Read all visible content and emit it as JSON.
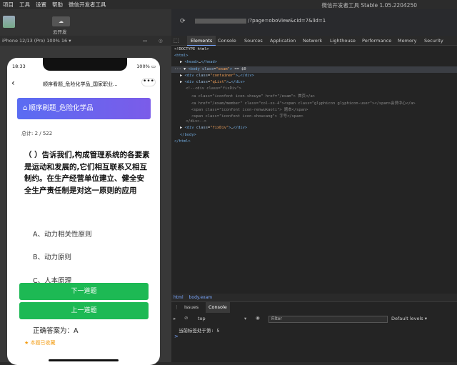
{
  "menu": [
    "项目",
    "工具",
    "设置",
    "帮助",
    "微信开发者工具"
  ],
  "app_title": "微信开发者工具 Stable 1.05.2204250",
  "toolbar": {
    "cloud_label": "云开发",
    "cloud_icon": "cloud-dev-icon"
  },
  "address": {
    "url_suffix": "/?page=oboView&cid=7&lid=1"
  },
  "simulator": {
    "device": "iPhone 12/13 (Pro) 100% 16 ▾"
  },
  "phone": {
    "time": "18:33",
    "battery": "100%",
    "nav_title": "顺序看题_危险化学品_国家职业...",
    "nav_dots": "•••",
    "banner": "顺序刷题_危险化学品",
    "total": "总计: 2 / 522",
    "question": "（ ）告诉我们,构成管理系统的各要素是运动和发展的,它们相互联系又相互制约。在生产经营单位建立、健全安全生产责任制是对这一原则的应用",
    "options": [
      "A、动力相关性原则",
      "B、动力原则",
      "C、人本原理"
    ],
    "next_button": "下一道题",
    "prev_button": "上一道题",
    "answer": "正确答案为：A",
    "favorite": "本题已收藏"
  },
  "devtools": {
    "tabs": [
      "Elements",
      "Console",
      "Sources",
      "Application",
      "Network",
      "Lighthouse",
      "Performance",
      "Memory",
      "Security"
    ],
    "lines": [
      {
        "indent": 0,
        "html": "&lt;!DOCTYPE html&gt;"
      },
      {
        "indent": 0,
        "html": "<span class='tag'>&lt;html&gt;</span>"
      },
      {
        "indent": 1,
        "html": "▶ <span class='tag'>&lt;head&gt;</span>…<span class='tag'>&lt;/head&gt;</span>"
      },
      {
        "indent": 0,
        "html": "··· ▼ <span class='tag'>&lt;body</span> <span class='attr'>class</span>=<span class='val'>\"exam\"</span><span class='tag'>&gt;</span> == $0"
      },
      {
        "indent": 1,
        "html": "▶ <span class='tag'>&lt;div</span> <span class='attr'>class</span>=<span class='val'>\"container\"</span><span class='tag'>&gt;</span>…<span class='tag'>&lt;/div&gt;</span>"
      },
      {
        "indent": 1,
        "html": "▶ <span class='tag'>&lt;div</span> <span class='attr'>class</span>=<span class='val'>\"qList\"</span><span class='tag'>&gt;</span>…<span class='tag'>&lt;/div&gt;</span>"
      },
      {
        "indent": 2,
        "html": "<span class='cmt'>&lt;!--&lt;div class=\"fixDiv\"&gt;</span>"
      },
      {
        "indent": 3,
        "html": "<span class='cmt'>&lt;a class=\"iconfont icon-shouye\" href=\"/exam\"&gt; 首页&lt;/a&gt;</span>"
      },
      {
        "indent": 3,
        "html": "<span class='cmt'>&lt;a href=\"/exam/member\" class=\"col-xs-4\"&gt;&lt;span class=\"glyphicon glyphicon-user\"&gt;&lt;/span&gt;会员中心&lt;/a&gt;</span>"
      },
      {
        "indent": 3,
        "html": "<span class='cmt'>&lt;span class=\"iconfont icon-renwukaoti\"&gt; 题本&lt;/span&gt;</span>"
      },
      {
        "indent": 3,
        "html": "<span class='cmt'>&lt;span class=\"iconfont icon-shoucang\"&gt; 字号&lt;/span&gt;</span>"
      },
      {
        "indent": 2,
        "html": "<span class='cmt'>&lt;/div&gt;--&gt;</span>"
      },
      {
        "indent": 1,
        "html": "▶ <span class='tag'>&lt;div</span> <span class='attr'>class</span>=<span class='val'>\"fixDiv\"</span><span class='tag'>&gt;</span>…<span class='tag'>&lt;/div&gt;</span>"
      },
      {
        "indent": 1,
        "html": "<span class='tag'>&lt;/body&gt;</span>"
      },
      {
        "indent": 0,
        "html": "<span class='tag'>&lt;/html&gt;</span>"
      }
    ],
    "breadcrumb": [
      "html",
      "body.exam"
    ],
    "drawer_tabs": [
      "Issues",
      "Console"
    ],
    "context": "top",
    "filter_placeholder": "Filter",
    "levels": "Default levels ▾",
    "log": "当前标签处于第: 5",
    "prompt": ">"
  }
}
